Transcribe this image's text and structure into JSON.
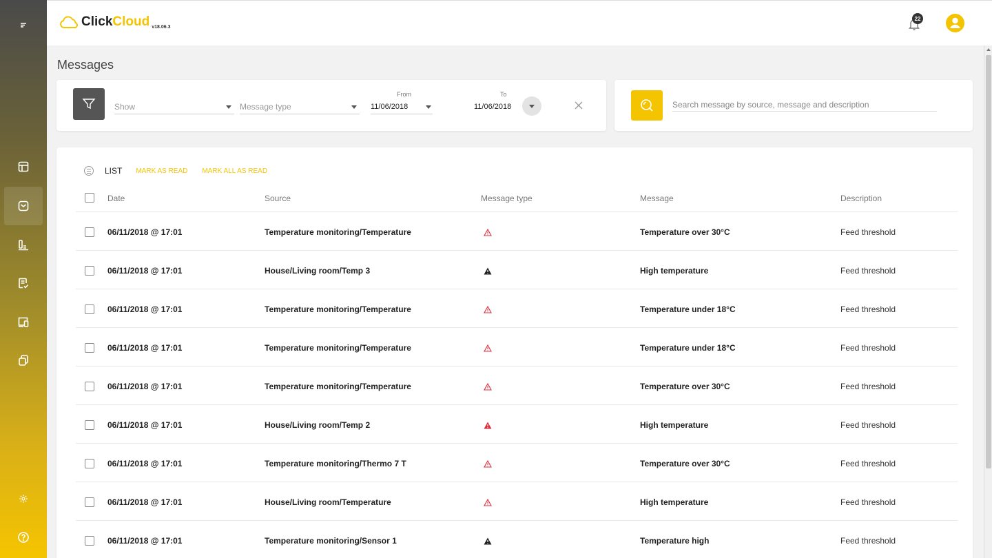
{
  "app": {
    "logo_text_a": "Click",
    "logo_text_b": "Cloud",
    "version": "v18.06.3",
    "notification_count": "22",
    "accent_color": "#f5c400"
  },
  "sidebar": {
    "items": [
      {
        "name": "menu-icon"
      },
      {
        "name": "dashboard-icon"
      },
      {
        "name": "messages-icon",
        "active": true
      },
      {
        "name": "reports-icon"
      },
      {
        "name": "tasks-icon"
      },
      {
        "name": "devices-icon"
      },
      {
        "name": "copy-icon"
      },
      {
        "name": "settings-icon"
      },
      {
        "name": "help-icon"
      }
    ]
  },
  "page": {
    "title": "Messages"
  },
  "filter": {
    "show_placeholder": "Show",
    "message_type_placeholder": "Message type",
    "from_label": "From",
    "from_value": "11/06/2018",
    "to_label": "To",
    "to_value": "11/06/2018"
  },
  "search": {
    "placeholder": "Search message by source, message and description"
  },
  "list": {
    "label": "LIST",
    "mark_as_read": "MARK AS READ",
    "mark_all_as_read": "MARK ALL AS READ",
    "columns": {
      "date": "Date",
      "source": "Source",
      "type": "Message type",
      "message": "Message",
      "description": "Description"
    },
    "rows": [
      {
        "date": "06/11/2018 @ 17:01",
        "source": "Temperature monitoring/Temperature",
        "type": "warning-outline-red",
        "message": "Temperature over 30°C",
        "description": "Feed threshold"
      },
      {
        "date": "06/11/2018 @ 17:01",
        "source": "House/Living room/Temp 3",
        "type": "warning-filled-black",
        "message": "High temperature",
        "description": "Feed threshold"
      },
      {
        "date": "06/11/2018 @ 17:01",
        "source": "Temperature monitoring/Temperature",
        "type": "warning-outline-red",
        "message": "Temperature under 18°C",
        "description": "Feed threshold"
      },
      {
        "date": "06/11/2018 @ 17:01",
        "source": "Temperature monitoring/Temperature",
        "type": "warning-outline-red",
        "message": "Temperature under 18°C",
        "description": "Feed threshold"
      },
      {
        "date": "06/11/2018 @ 17:01",
        "source": "Temperature monitoring/Temperature",
        "type": "warning-outline-red",
        "message": "Temperature over 30°C",
        "description": "Feed threshold"
      },
      {
        "date": "06/11/2018 @ 17:01",
        "source": "House/Living room/Temp 2",
        "type": "warning-filled-red",
        "message": "High temperature",
        "description": "Feed threshold"
      },
      {
        "date": "06/11/2018 @ 17:01",
        "source": "Temperature monitoring/Thermo 7 T",
        "type": "warning-outline-red",
        "message": "Temperature over 30°C",
        "description": "Feed threshold"
      },
      {
        "date": "06/11/2018 @ 17:01",
        "source": "House/Living room/Temperature",
        "type": "warning-outline-red",
        "message": "High temperature",
        "description": "Feed threshold"
      },
      {
        "date": "06/11/2018 @ 17:01",
        "source": "Temperature monitoring/Sensor 1",
        "type": "warning-filled-black",
        "message": "Temperature high",
        "description": "Feed threshold"
      }
    ]
  }
}
